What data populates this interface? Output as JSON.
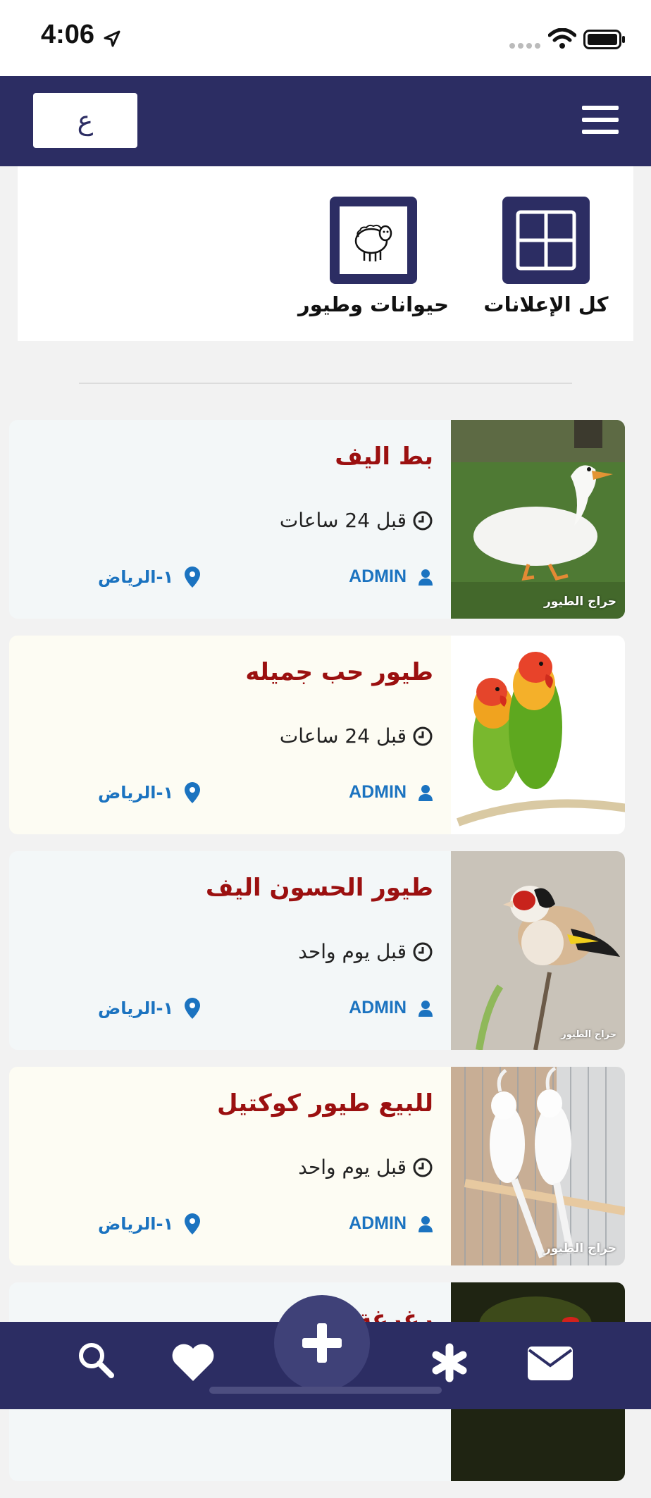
{
  "status_bar": {
    "time": "4:06"
  },
  "header": {
    "lang_label": "ع"
  },
  "categories": [
    {
      "label": "كل الإعلانات",
      "icon": "grid-icon"
    },
    {
      "label": "حيوانات وطيور",
      "icon": "sheep-icon"
    }
  ],
  "ads": [
    {
      "title": "بط اليف",
      "time": "قبل 24 ساعات",
      "user": "ADMIN",
      "location": "١-الرياض",
      "watermark": "حراج الطيور",
      "image": "duck"
    },
    {
      "title": "طيور حب جميله",
      "time": "قبل 24 ساعات",
      "user": "ADMIN",
      "location": "١-الرياض",
      "watermark": "",
      "image": "lovebirds"
    },
    {
      "title": "طيور الحسون اليف",
      "time": "قبل يوم واحد",
      "user": "ADMIN",
      "location": "١-الرياض",
      "watermark": "حراج الطيور",
      "image": "goldfinch"
    },
    {
      "title": "للبيع طيور كوكتيل",
      "time": "قبل يوم واحد",
      "user": "ADMIN",
      "location": "١-الرياض",
      "watermark": "حراج الطيور",
      "image": "cockatiel"
    },
    {
      "title": "رغرغة",
      "time": "",
      "user": "",
      "location": "",
      "watermark": "",
      "image": "dark"
    }
  ],
  "bottom_nav": {
    "items": [
      "search-icon",
      "heart-icon",
      "add-icon",
      "asterisk-icon",
      "mail-icon"
    ]
  },
  "colors": {
    "primary": "#2c2d63",
    "title_red": "#9b1010",
    "link_blue": "#1b73c0"
  }
}
